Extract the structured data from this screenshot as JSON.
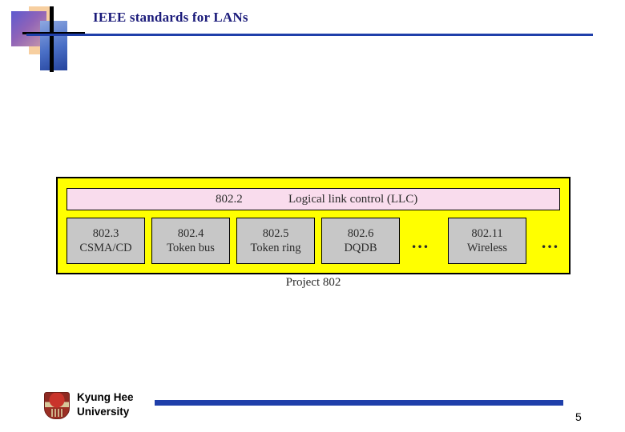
{
  "slide": {
    "title": "IEEE standards for LANs",
    "project_label": "Project 802",
    "page_number": "5",
    "footer": {
      "org_line1": "Kyung Hee",
      "org_line2": "University"
    }
  },
  "diagram": {
    "llc": {
      "number": "802.2",
      "label": "Logical link control (LLC)"
    },
    "mac_layers": [
      {
        "number": "802.3",
        "name": "CSMA/CD"
      },
      {
        "number": "802.4",
        "name": "Token bus"
      },
      {
        "number": "802.5",
        "name": "Token ring"
      },
      {
        "number": "802.6",
        "name": "DQDB"
      },
      {
        "number": "802.11",
        "name": "Wireless"
      }
    ],
    "ellipsis_inner": "…",
    "ellipsis_outer": "…",
    "colors": {
      "project_fill": "#ffff00",
      "llc_fill": "#f9dced",
      "mac_fill": "#c7c7c7",
      "accent": "#1f3faa",
      "title": "#1b1b7a"
    }
  }
}
